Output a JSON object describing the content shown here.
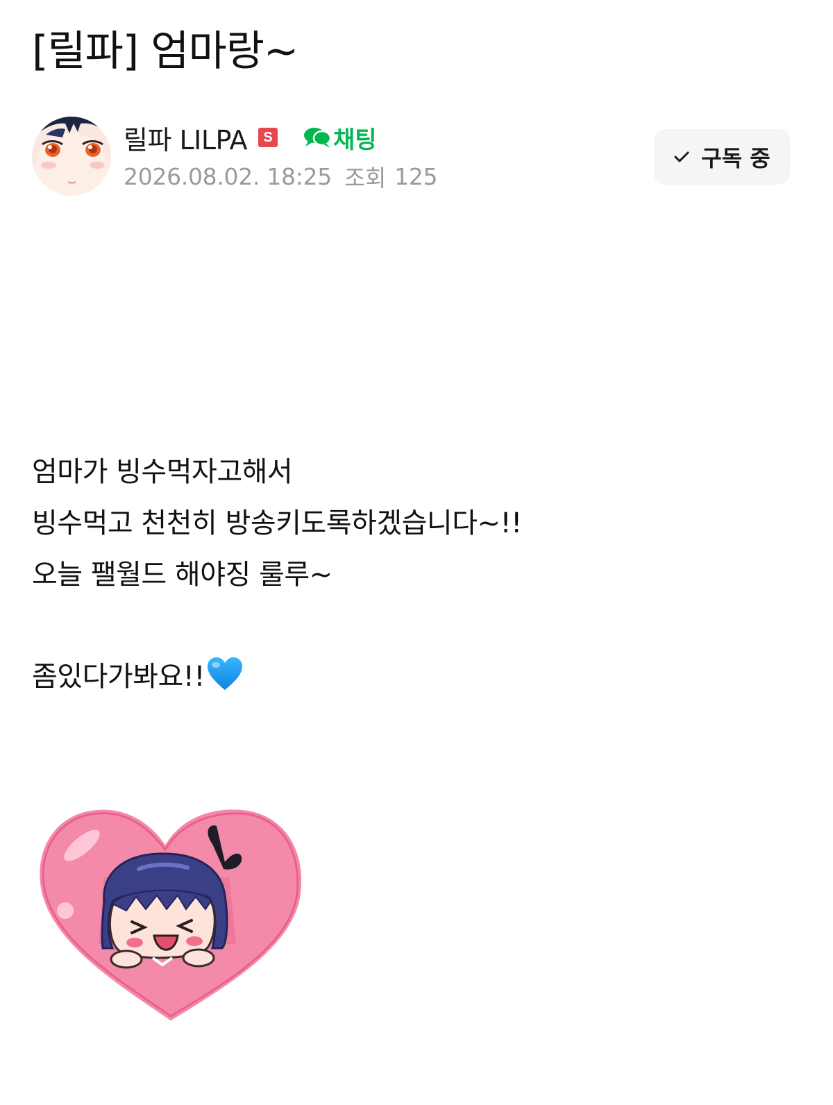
{
  "post": {
    "title": "[릴파] 엄마랑~"
  },
  "author": {
    "name": "릴파 LILPA",
    "badge": "S",
    "chat_label": "채팅",
    "avatar_icon": "anime-girl-avatar"
  },
  "meta": {
    "datetime": "2026.08.02. 18:25",
    "views_label": "조회",
    "views_count": "125"
  },
  "subscribe": {
    "label": "구독 중",
    "icon": "check-icon"
  },
  "content": {
    "lines": [
      "엄마가 빙수먹자고해서",
      "빙수먹고 천천히 방송키도록하겠습니다~!!",
      "오늘 팰월드 해야징 룰루~",
      "좀있다가봐요!!"
    ],
    "trailing_emoji": "blue-heart-icon",
    "sticker": "heart-girl-sticker"
  },
  "colors": {
    "chat_green": "#00b84f",
    "badge_red": "#e5484d",
    "meta_gray": "#9a9a9a",
    "heart_blue": "#1a9cf0",
    "sticker_pink": "#f687a8"
  }
}
